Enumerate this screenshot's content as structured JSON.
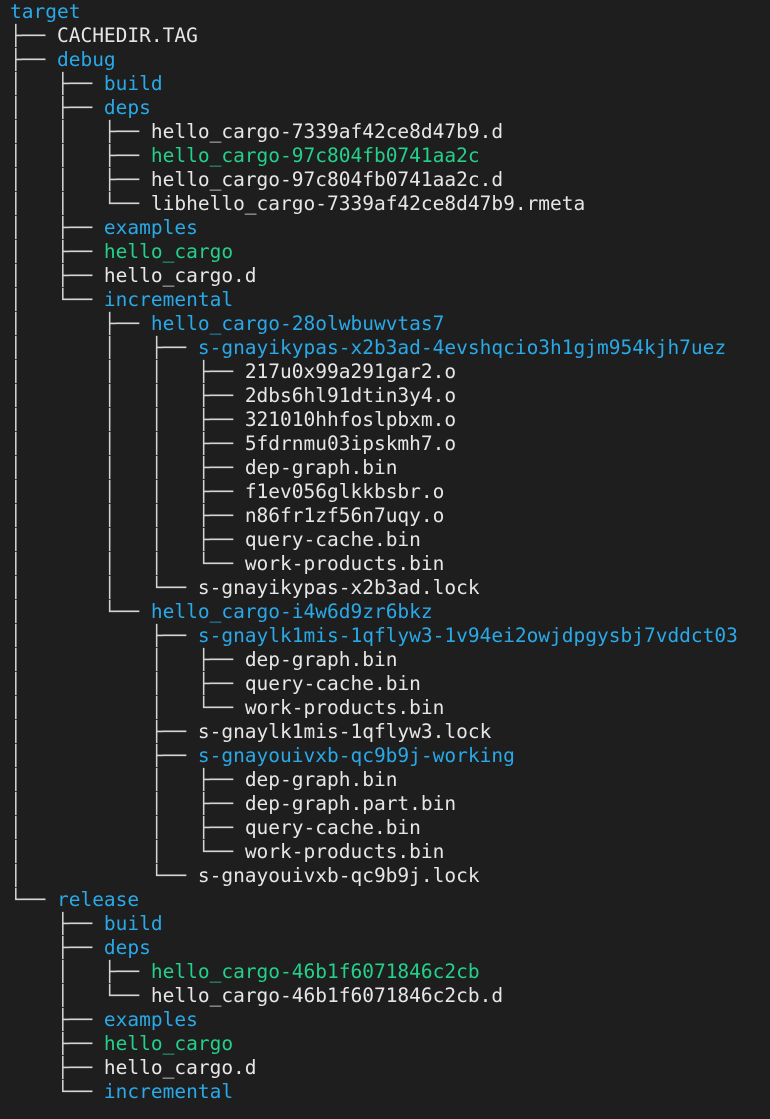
{
  "tree": [
    {
      "prefix": "",
      "name": "target",
      "kind": "dir"
    },
    {
      "prefix": "├── ",
      "name": "CACHEDIR.TAG",
      "kind": "file"
    },
    {
      "prefix": "├── ",
      "name": "debug",
      "kind": "dir"
    },
    {
      "prefix": "│   ├── ",
      "name": "build",
      "kind": "dir"
    },
    {
      "prefix": "│   ├── ",
      "name": "deps",
      "kind": "dir"
    },
    {
      "prefix": "│   │   ├── ",
      "name": "hello_cargo-7339af42ce8d47b9.d",
      "kind": "file"
    },
    {
      "prefix": "│   │   ├── ",
      "name": "hello_cargo-97c804fb0741aa2c",
      "kind": "exe"
    },
    {
      "prefix": "│   │   ├── ",
      "name": "hello_cargo-97c804fb0741aa2c.d",
      "kind": "file"
    },
    {
      "prefix": "│   │   └── ",
      "name": "libhello_cargo-7339af42ce8d47b9.rmeta",
      "kind": "file"
    },
    {
      "prefix": "│   ├── ",
      "name": "examples",
      "kind": "dir"
    },
    {
      "prefix": "│   ├── ",
      "name": "hello_cargo",
      "kind": "exe"
    },
    {
      "prefix": "│   ├── ",
      "name": "hello_cargo.d",
      "kind": "file"
    },
    {
      "prefix": "│   └── ",
      "name": "incremental",
      "kind": "dir"
    },
    {
      "prefix": "│       ├── ",
      "name": "hello_cargo-28olwbuwvtas7",
      "kind": "dir"
    },
    {
      "prefix": "│       │   ├── ",
      "name": "s-gnayikypas-x2b3ad-4evshqcio3h1gjm954kjh7uez",
      "kind": "dir"
    },
    {
      "prefix": "│       │   │   ├── ",
      "name": "217u0x99a291gar2.o",
      "kind": "file"
    },
    {
      "prefix": "│       │   │   ├── ",
      "name": "2dbs6hl91dtin3y4.o",
      "kind": "file"
    },
    {
      "prefix": "│       │   │   ├── ",
      "name": "321010hhfoslpbxm.o",
      "kind": "file"
    },
    {
      "prefix": "│       │   │   ├── ",
      "name": "5fdrnmu03ipskmh7.o",
      "kind": "file"
    },
    {
      "prefix": "│       │   │   ├── ",
      "name": "dep-graph.bin",
      "kind": "file"
    },
    {
      "prefix": "│       │   │   ├── ",
      "name": "f1ev056glkkbsbr.o",
      "kind": "file"
    },
    {
      "prefix": "│       │   │   ├── ",
      "name": "n86fr1zf56n7uqy.o",
      "kind": "file"
    },
    {
      "prefix": "│       │   │   ├── ",
      "name": "query-cache.bin",
      "kind": "file"
    },
    {
      "prefix": "│       │   │   └── ",
      "name": "work-products.bin",
      "kind": "file"
    },
    {
      "prefix": "│       │   └── ",
      "name": "s-gnayikypas-x2b3ad.lock",
      "kind": "file"
    },
    {
      "prefix": "│       └── ",
      "name": "hello_cargo-i4w6d9zr6bkz",
      "kind": "dir"
    },
    {
      "prefix": "│           ├── ",
      "name": "s-gnaylk1mis-1qflyw3-1v94ei2owjdpgysbj7vddct03",
      "kind": "dir"
    },
    {
      "prefix": "│           │   ├── ",
      "name": "dep-graph.bin",
      "kind": "file"
    },
    {
      "prefix": "│           │   ├── ",
      "name": "query-cache.bin",
      "kind": "file"
    },
    {
      "prefix": "│           │   └── ",
      "name": "work-products.bin",
      "kind": "file"
    },
    {
      "prefix": "│           ├── ",
      "name": "s-gnaylk1mis-1qflyw3.lock",
      "kind": "file"
    },
    {
      "prefix": "│           ├── ",
      "name": "s-gnayouivxb-qc9b9j-working",
      "kind": "dir"
    },
    {
      "prefix": "│           │   ├── ",
      "name": "dep-graph.bin",
      "kind": "file"
    },
    {
      "prefix": "│           │   ├── ",
      "name": "dep-graph.part.bin",
      "kind": "file"
    },
    {
      "prefix": "│           │   ├── ",
      "name": "query-cache.bin",
      "kind": "file"
    },
    {
      "prefix": "│           │   └── ",
      "name": "work-products.bin",
      "kind": "file"
    },
    {
      "prefix": "│           └── ",
      "name": "s-gnayouivxb-qc9b9j.lock",
      "kind": "file"
    },
    {
      "prefix": "└── ",
      "name": "release",
      "kind": "dir"
    },
    {
      "prefix": "    ├── ",
      "name": "build",
      "kind": "dir"
    },
    {
      "prefix": "    ├── ",
      "name": "deps",
      "kind": "dir"
    },
    {
      "prefix": "    │   ├── ",
      "name": "hello_cargo-46b1f6071846c2cb",
      "kind": "exe"
    },
    {
      "prefix": "    │   └── ",
      "name": "hello_cargo-46b1f6071846c2cb.d",
      "kind": "file"
    },
    {
      "prefix": "    ├── ",
      "name": "examples",
      "kind": "dir"
    },
    {
      "prefix": "    ├── ",
      "name": "hello_cargo",
      "kind": "exe"
    },
    {
      "prefix": "    ├── ",
      "name": "hello_cargo.d",
      "kind": "file"
    },
    {
      "prefix": "    └── ",
      "name": "incremental",
      "kind": "dir"
    }
  ],
  "colors": {
    "background": "#1e1e1e",
    "tree_lines": "#d4d4d4",
    "file": "#e6e6e6",
    "directory": "#29a9e8",
    "executable": "#23d18b"
  }
}
